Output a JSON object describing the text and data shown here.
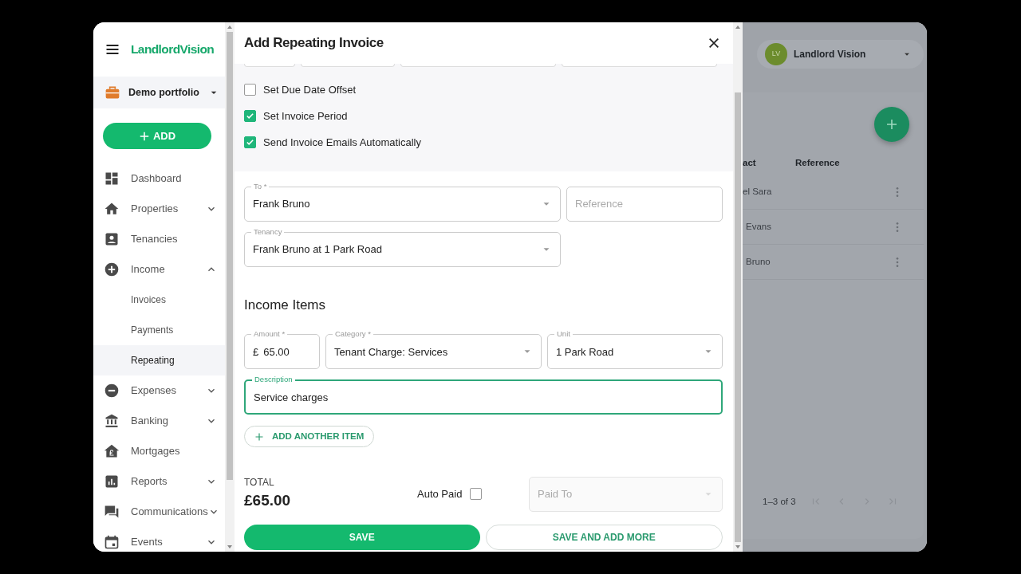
{
  "sidebar": {
    "logo": "LandlordVision",
    "portfolio": "Demo portfolio",
    "add_button": "ADD",
    "items": [
      {
        "label": "Dashboard",
        "kind": "link"
      },
      {
        "label": "Properties",
        "kind": "group",
        "expanded": false
      },
      {
        "label": "Tenancies",
        "kind": "link"
      },
      {
        "label": "Income",
        "kind": "group",
        "expanded": true,
        "children": [
          {
            "label": "Invoices",
            "selected": false
          },
          {
            "label": "Payments",
            "selected": false
          },
          {
            "label": "Repeating",
            "selected": true
          }
        ]
      },
      {
        "label": "Expenses",
        "kind": "group",
        "expanded": false
      },
      {
        "label": "Banking",
        "kind": "group",
        "expanded": false
      },
      {
        "label": "Mortgages",
        "kind": "link"
      },
      {
        "label": "Reports",
        "kind": "group",
        "expanded": false
      },
      {
        "label": "Communications",
        "kind": "group",
        "expanded": false
      },
      {
        "label": "Events",
        "kind": "group",
        "expanded": false
      }
    ]
  },
  "modal": {
    "title": "Add Repeating Invoice",
    "checkboxes": [
      {
        "label": "Set Due Date Offset",
        "checked": false
      },
      {
        "label": "Set Invoice Period",
        "checked": true
      },
      {
        "label": "Send Invoice Emails Automatically",
        "checked": true
      }
    ],
    "to": {
      "label": "To *",
      "value": "Frank Bruno"
    },
    "reference": {
      "placeholder": "Reference"
    },
    "tenancy": {
      "label": "Tenancy",
      "value": "Frank Bruno at 1 Park Road"
    },
    "items_heading": "Income Items",
    "items": [
      {
        "amount": {
          "label": "Amount *",
          "currency": "£",
          "value": "65.00"
        },
        "category": {
          "label": "Category *",
          "value": "Tenant Charge: Services"
        },
        "unit": {
          "label": "Unit",
          "value": "1 Park Road"
        },
        "description": {
          "label": "Description",
          "value": "Service charges",
          "focused": true
        }
      }
    ],
    "add_item_button": "ADD ANOTHER ITEM",
    "total_label": "TOTAL",
    "total": "£65.00",
    "auto_paid": {
      "label": "Auto Paid",
      "checked": false
    },
    "paid_to": {
      "placeholder": "Paid To",
      "disabled": true
    },
    "buttons": [
      {
        "label": "SAVE",
        "kind": "primary"
      },
      {
        "label": "SAVE AND ADD MORE",
        "kind": "outline"
      }
    ]
  },
  "background": {
    "user": {
      "initials": "LV",
      "name": "Landlord Vision"
    },
    "table": {
      "columns": [
        "act",
        "Reference"
      ],
      "rows": [
        {
          "column_1": "el Sara"
        },
        {
          "column_1": "Evans"
        },
        {
          "column_1": "Bruno"
        }
      ]
    },
    "pagination": "1–3 of 3"
  }
}
